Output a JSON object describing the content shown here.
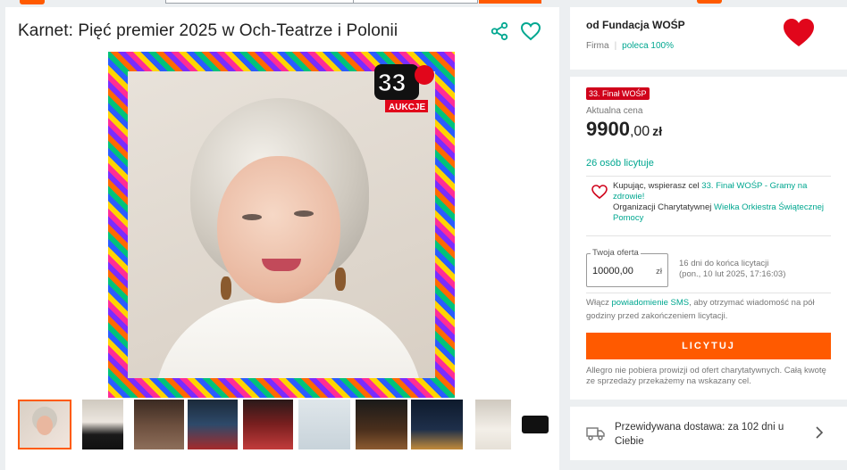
{
  "listing": {
    "title": "Karnet: Pięć premier 2025 w Och-Teatrze i Polonii",
    "image_badge": "33 FINAŁ AUKCJE",
    "thumbnail_count": 10
  },
  "seller": {
    "name": "od Fundacja WOŚP",
    "type": "Firma",
    "recommend": "poleca 100%"
  },
  "offer": {
    "tag": "33. Finał WOŚP",
    "price_label": "Aktualna cena",
    "price_major": "9900",
    "price_minor": ",00",
    "currency": "zł",
    "bidders": "26 osób licytuje",
    "charity_line1_prefix": "Kupując, wspierasz cel ",
    "charity_line1_link": "33. Finał WOŚP - Gramy na zdrowie!",
    "charity_line2_prefix": "Organizacji Charytatywnej ",
    "charity_line2_link": "Wielka Orkiestra Świątecznej Pomocy",
    "bid_legend": "Twoja oferta",
    "bid_value": "10000,00",
    "bid_currency": "zł",
    "time_left": "16 dni do końca licytacji",
    "end_date": "(pon., 10 lut 2025, 17:16:03)",
    "sms_prefix": "Włącz ",
    "sms_link": "powiadomienie SMS",
    "sms_suffix": ", aby otrzymać wiadomość na pół godziny przed zakończeniem licytacji.",
    "bid_button": "LICYTUJ",
    "note": "Allegro nie pobiera prowizji od ofert charytatywnych. Całą kwotę ze sprzedaży przekażemy na wskazany cel."
  },
  "delivery": {
    "text": "Przewidywana dostawa: za 102 dni u Ciebie"
  },
  "colors": {
    "accent": "#ff5a00",
    "link": "#00a790",
    "tag": "#d0021b"
  }
}
